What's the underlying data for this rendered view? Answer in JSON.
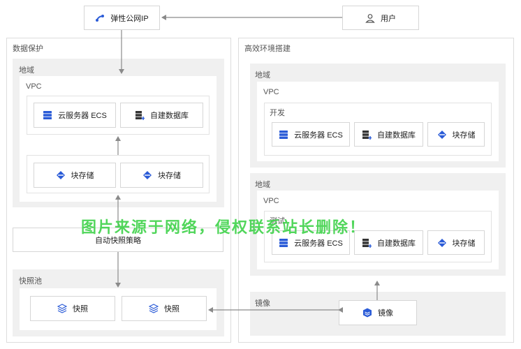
{
  "eip": "弹性公网IP",
  "user": "用户",
  "left": {
    "title": "数据保护",
    "region": "地域",
    "vpc": "VPC",
    "ecs": "云服务器 ECS",
    "db": "自建数据库",
    "storage_a": "块存储",
    "storage_b": "块存储",
    "policy": "自动快照策略",
    "pool": "快照池",
    "snap_a": "快照",
    "snap_b": "快照"
  },
  "right": {
    "title": "高效环境搭建",
    "region_1": "地域",
    "vpc_1": "VPC",
    "dev": "开发",
    "dev_ecs": "云服务器 ECS",
    "dev_db": "自建数据库",
    "dev_storage": "块存储",
    "region_2": "地域",
    "vpc_2": "VPC",
    "test": "测试",
    "test_ecs": "云服务器 ECS",
    "test_db": "自建数据库",
    "test_storage": "块存储",
    "mirror_group": "镜像",
    "mirror": "镜像"
  },
  "watermark": "图片来源于网络，侵权联系站长删除！",
  "colors": {
    "icon_blue": "#2a5bd7",
    "arrow": "#8a8a8a",
    "watermark": "#3fd24a"
  }
}
